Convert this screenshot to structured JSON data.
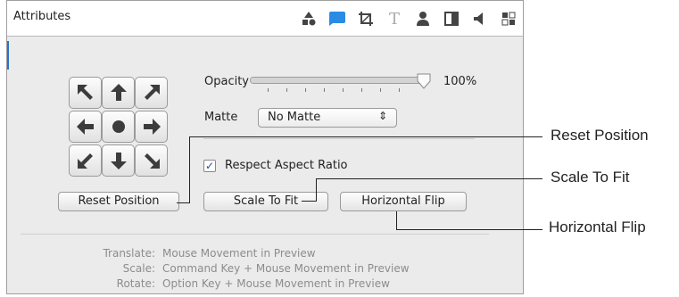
{
  "titlebar": {
    "title": "Attributes",
    "icons": [
      "shapes-icon",
      "speech-bubble-icon",
      "crop-icon",
      "text-icon",
      "person-icon",
      "half-square-icon",
      "speaker-icon",
      "grid-icon"
    ],
    "active_icon": "speech-bubble-icon"
  },
  "controls": {
    "opacity_label": "Opacity",
    "opacity_value": "100%",
    "opacity_fraction": 1.0,
    "matte_label": "Matte",
    "matte_selected": "No Matte",
    "respect_aspect_label": "Respect Aspect Ratio",
    "respect_aspect_checked": true,
    "reset_position_label": "Reset Position",
    "scale_to_fit_label": "Scale To Fit",
    "horizontal_flip_label": "Horizontal Flip"
  },
  "help": {
    "translate_key": "Translate:",
    "translate_value": "Mouse Movement in Preview",
    "scale_key": "Scale:",
    "scale_value": "Command Key + Mouse Movement in Preview",
    "rotate_key": "Rotate:",
    "rotate_value": "Option Key + Mouse Movement in Preview"
  },
  "callouts": {
    "reset_position": "Reset Position",
    "scale_to_fit": "Scale To Fit",
    "horizontal_flip": "Horizontal Flip"
  },
  "colors": {
    "accent": "#2a8be4",
    "panel_bg": "#ebebeb",
    "help_text": "#8c8c8c"
  }
}
